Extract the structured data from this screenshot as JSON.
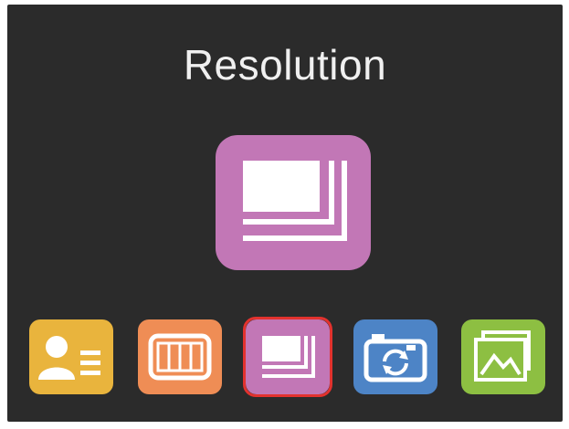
{
  "screen": {
    "title": "Resolution"
  },
  "hero_icon": {
    "icon": "resolution-icon",
    "color": "#c277b6"
  },
  "dock": {
    "selected": "resolution",
    "items": [
      {
        "id": "contacts",
        "icon": "contacts-icon",
        "color": "#e9b43d"
      },
      {
        "id": "video",
        "icon": "film-icon",
        "color": "#ef8d55"
      },
      {
        "id": "resolution",
        "icon": "resolution-icon",
        "color": "#c277b6"
      },
      {
        "id": "camera",
        "icon": "camera-rotate-icon",
        "color": "#4d84c6"
      },
      {
        "id": "gallery",
        "icon": "gallery-icon",
        "color": "#8dbf42"
      }
    ],
    "selection_color": "#e2322e"
  },
  "theme": {
    "background": "#2b2b2b",
    "text": "#f0f0f0"
  }
}
